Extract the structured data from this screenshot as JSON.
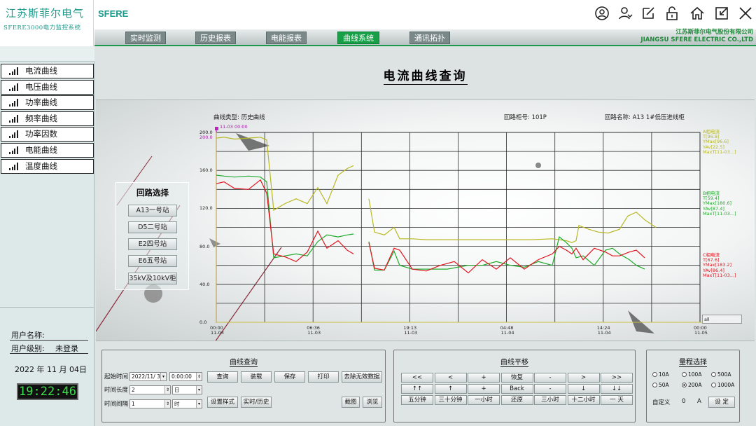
{
  "brand": {
    "name_cn": "江苏斯菲尔电气",
    "system": "SFERE3000电力监控系统",
    "logo": "SFERE"
  },
  "top_icons": [
    "user-circle-icon",
    "users-icon",
    "edit-icon",
    "unlock-icon",
    "home-icon",
    "shrink-icon",
    "close-icon"
  ],
  "nav": {
    "tabs": [
      "实时监测",
      "历史报表",
      "电能报表",
      "曲线系统",
      "通讯拓扑"
    ],
    "active": "曲线系统"
  },
  "corp": {
    "cn": "江苏斯菲尔电气股份有限公司",
    "en": "JIANGSU SFERE ELECTRIC CO.,LTD"
  },
  "sidebar": {
    "items": [
      "电流曲线",
      "电压曲线",
      "功率曲线",
      "频率曲线",
      "功率因数",
      "电能曲线",
      "温度曲线"
    ]
  },
  "user": {
    "name_label": "用户名称:",
    "name_value": "",
    "level_label": "用户级别:",
    "level_value": "未登录",
    "date": "2022 年 11 月 04日",
    "time": "19:22:46"
  },
  "page_title": "电流曲线查询",
  "chart_header": {
    "type": "曲线类型: 历史曲线",
    "cabinet": "回路柜号: 101P",
    "circuit": "回路名称: A13 1#低压进线柜"
  },
  "circuit_select": {
    "title": "回路选择",
    "buttons": [
      "A13一号站",
      "D5二号站",
      "E2四号站",
      "E6五号站",
      "35kV及10kV柜"
    ]
  },
  "chart_data": {
    "type": "line",
    "ylim": [
      0,
      200
    ],
    "yticks": [
      "200.0",
      "160.0",
      "120.0",
      "80.0",
      "40.0",
      "0.0"
    ],
    "xticks": [
      {
        "t": "00:00",
        "d": "11-03"
      },
      {
        "t": "06:36",
        "d": "11-03"
      },
      {
        "t": "19:13",
        "d": "11-03"
      },
      {
        "t": "04:48",
        "d": "11-04"
      },
      {
        "t": "14:24",
        "d": "11-04"
      },
      {
        "t": "00:00",
        "d": "11-05"
      }
    ],
    "cursor_label": "11-03 00:00",
    "cursor_value": "200.0",
    "all_label": "all",
    "colors": {
      "A": "#b8b820",
      "B": "#1faa2a",
      "C": "#e0141e",
      "grid": "#2a2a2a"
    },
    "series": [
      {
        "name": "A相电流",
        "color": "#b8b820",
        "segments": [
          [
            [
              0,
              194
            ],
            [
              11,
              195
            ],
            [
              26,
              193
            ],
            [
              46,
              194
            ],
            [
              63,
              195
            ],
            [
              72,
              192
            ],
            [
              82,
              118
            ],
            [
              98,
              125
            ],
            [
              114,
              130
            ],
            [
              130,
              125
            ],
            [
              145,
              142
            ],
            [
              158,
              125
            ],
            [
              174,
              155
            ],
            [
              187,
              162
            ],
            [
              196,
              165
            ]
          ],
          [
            [
              218,
              130
            ],
            [
              226,
              95
            ],
            [
              240,
              92
            ],
            [
              254,
              100
            ],
            [
              262,
              88
            ],
            [
              280,
              88
            ],
            [
              300,
              87
            ],
            [
              330,
              87
            ],
            [
              360,
              87
            ],
            [
              390,
              87
            ],
            [
              420,
              87
            ],
            [
              450,
              87
            ],
            [
              480,
              88
            ],
            [
              500,
              86
            ],
            [
              508,
              84
            ],
            [
              514,
              86
            ],
            [
              518,
              102
            ],
            [
              532,
              98
            ],
            [
              546,
              95
            ],
            [
              560,
              94
            ],
            [
              576,
              98
            ],
            [
              588,
              112
            ],
            [
              600,
              116
            ],
            [
              612,
              108
            ],
            [
              620,
              104
            ],
            [
              628,
              100
            ]
          ]
        ]
      },
      {
        "name": "B相电流",
        "color": "#1faa2a",
        "segments": [
          [
            [
              0,
              155
            ],
            [
              11,
              154
            ],
            [
              26,
              153
            ],
            [
              46,
              154
            ],
            [
              63,
              153
            ],
            [
              72,
              148
            ],
            [
              82,
              68
            ],
            [
              98,
              70
            ],
            [
              114,
              72
            ],
            [
              130,
              70
            ],
            [
              145,
              85
            ],
            [
              158,
              92
            ],
            [
              174,
              90
            ],
            [
              187,
              92
            ],
            [
              196,
              93
            ]
          ],
          [
            [
              218,
              85
            ],
            [
              226,
              55
            ],
            [
              240,
              55
            ],
            [
              254,
              75
            ],
            [
              262,
              60
            ],
            [
              280,
              56
            ],
            [
              300,
              56
            ],
            [
              330,
              56
            ],
            [
              360,
              60
            ],
            [
              380,
              60
            ],
            [
              400,
              64
            ],
            [
              420,
              60
            ],
            [
              440,
              58
            ],
            [
              460,
              64
            ],
            [
              480,
              60
            ],
            [
              490,
              90
            ],
            [
              500,
              84
            ],
            [
              508,
              78
            ],
            [
              514,
              68
            ],
            [
              524,
              70
            ],
            [
              540,
              60
            ],
            [
              556,
              76
            ],
            [
              566,
              78
            ],
            [
              576,
              72
            ],
            [
              590,
              66
            ],
            [
              600,
              60
            ],
            [
              612,
              56
            ]
          ]
        ]
      },
      {
        "name": "C相电流",
        "color": "#e0141e",
        "segments": [
          [
            [
              0,
              146
            ],
            [
              11,
              148
            ],
            [
              26,
              141
            ],
            [
              46,
              140
            ],
            [
              63,
              150
            ],
            [
              72,
              136
            ],
            [
              82,
              72
            ],
            [
              98,
              69
            ],
            [
              114,
              64
            ],
            [
              130,
              74
            ],
            [
              145,
              96
            ],
            [
              158,
              78
            ],
            [
              174,
              86
            ],
            [
              187,
              76
            ],
            [
              196,
              72
            ]
          ],
          [
            [
              218,
              84
            ],
            [
              226,
              57
            ],
            [
              240,
              55
            ],
            [
              254,
              78
            ],
            [
              262,
              76
            ],
            [
              280,
              56
            ],
            [
              300,
              54
            ],
            [
              320,
              60
            ],
            [
              340,
              64
            ],
            [
              360,
              52
            ],
            [
              380,
              66
            ],
            [
              400,
              56
            ],
            [
              420,
              68
            ],
            [
              440,
              56
            ],
            [
              460,
              66
            ],
            [
              480,
              72
            ],
            [
              490,
              80
            ],
            [
              500,
              76
            ],
            [
              508,
              72
            ],
            [
              514,
              78
            ],
            [
              524,
              66
            ],
            [
              540,
              78
            ],
            [
              556,
              74
            ],
            [
              566,
              70
            ],
            [
              576,
              70
            ],
            [
              590,
              74
            ],
            [
              600,
              76
            ],
            [
              612,
              68
            ]
          ]
        ]
      }
    ],
    "legends": [
      {
        "phase": "A相电流",
        "lines": [
          "T[96.8]",
          "YMax[96.6]",
          "YAv[22.5]",
          "MaxT[11-03...]"
        ]
      },
      {
        "phase": "B相电流",
        "lines": [
          "T[59.4]",
          "YMax[180.6]",
          "YAv[87.4]",
          "MaxT[11-03...]"
        ]
      },
      {
        "phase": "C相电流",
        "lines": [
          "T[67.6]",
          "YMax[183.2]",
          "YAv[86.4]",
          "MaxT[11-03...]"
        ]
      }
    ]
  },
  "query_panel": {
    "title": "曲线查询",
    "start_label": "起始时间",
    "start_date": "2022/11/ 3",
    "start_time": "0:00:00",
    "length_label": "时间长度",
    "length_value": "2",
    "length_unit": "日",
    "interval_label": "时间间隔",
    "interval_value": "1",
    "interval_unit": "时",
    "buttons_row1": [
      "查询",
      "装载",
      "保存",
      "打印",
      "去除无效数据"
    ],
    "buttons_row2": [
      "设置样式",
      "实时/历史"
    ],
    "buttons_right": [
      "截图",
      "浏览"
    ]
  },
  "shift_panel": {
    "title": "曲线平移",
    "row1": [
      "<<",
      "<",
      "+",
      "恢复",
      "-",
      ">",
      ">>"
    ],
    "row2": [
      "↑↑",
      "↑",
      "+",
      "Back",
      "-",
      "↓",
      "↓↓"
    ],
    "row3": [
      "五分钟",
      "三十分钟",
      "一小时",
      "还原",
      "三小时",
      "十二小时",
      "一 天"
    ]
  },
  "range_panel": {
    "title": "量程选择",
    "options": [
      "10A",
      "100A",
      "500A",
      "50A",
      "200A",
      "1000A"
    ],
    "selected": "200A",
    "custom_label": "自定义",
    "custom_value": "0",
    "custom_unit": "A",
    "set_button": "设 定"
  }
}
